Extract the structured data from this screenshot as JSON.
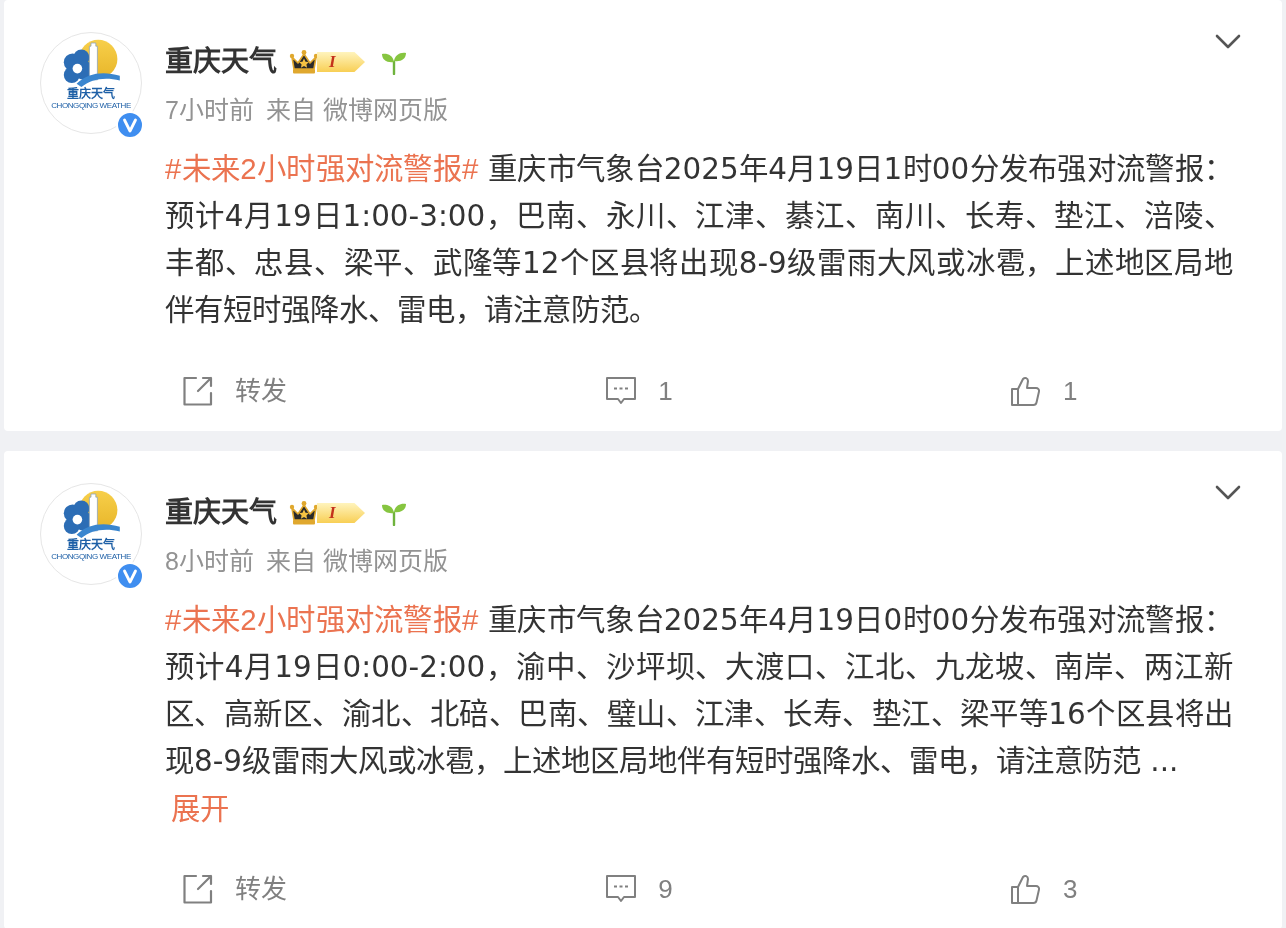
{
  "posts": [
    {
      "author": {
        "name": "重庆天气",
        "logo_text": "重庆天气",
        "logo_caption": "CHONGQING WEATHE",
        "verified": true,
        "level_badge": "I"
      },
      "time": "7小时前",
      "source": "来自 微博网页版",
      "topic": "#未来2小时强对流警报#",
      "text": "重庆市气象台2025年4月19日1时00分发布强对流警报：预计4月19日1:00-3:00，巴南、永川、江津、綦江、南川、长寿、垫江、涪陵、丰都、忠县、梁平、武隆等12个区县将出现8-9级雷雨大风或冰雹，上述地区局地伴有短时强降水、雷电，请注意防范。",
      "actions": [
        {
          "kind": "repost",
          "label": "转发"
        },
        {
          "kind": "comment",
          "label": "1"
        },
        {
          "kind": "like",
          "label": "1"
        }
      ]
    },
    {
      "author": {
        "name": "重庆天气",
        "logo_text": "重庆天气",
        "logo_caption": "CHONGQING WEATHE",
        "verified": true,
        "level_badge": "I"
      },
      "time": "8小时前",
      "source": "来自 微博网页版",
      "topic": "#未来2小时强对流警报#",
      "text": "重庆市气象台2025年4月19日0时00分发布强对流警报：预计4月19日0:00-2:00，渝中、沙坪坝、大渡口、江北、九龙坡、南岸、两江新区、高新区、渝北、北碚、巴南、璧山、江津、长寿、垫江、梁平等16个区县将出现8-9级雷雨大风或冰雹，上述地区局地伴有短时强降水、雷电，请注意防范 ...",
      "expand": "展开",
      "actions": [
        {
          "kind": "repost",
          "label": "转发"
        },
        {
          "kind": "comment",
          "label": "9"
        },
        {
          "kind": "like",
          "label": "3"
        }
      ]
    }
  ]
}
